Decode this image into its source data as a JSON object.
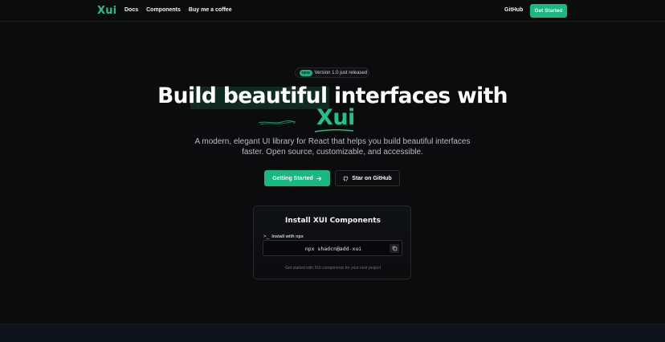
{
  "nav": {
    "logo": "Xui",
    "links": [
      "Docs",
      "Components",
      "Buy me a coffee"
    ],
    "github": "GitHub",
    "cta": "Get Started"
  },
  "hero": {
    "badge_tag": "NEW",
    "badge_text": "Version 1.0 just released",
    "title_line1": "Build beautiful interfaces with",
    "title_line2": "Xui",
    "subtitle_line1": "A modern, elegant UI library for React that helps you build beautiful interfaces",
    "subtitle_line2": "faster. Open source, customizable, and accessible.",
    "primary_button": "Getting Started",
    "secondary_button": "Star on GitHub"
  },
  "install": {
    "title": "Install XUI Components",
    "label": "Install with npx",
    "command": "npx shadcn@add-xui",
    "footnote": "Get started with XUI components for your next project"
  },
  "icons": {
    "terminal": "terminal-icon",
    "copy": "copy-icon",
    "arrow": "arrow-right-icon",
    "github": "github-icon"
  },
  "colors": {
    "accent": "#19b882",
    "background": "#0b0c0d",
    "text": "#ffffff"
  }
}
